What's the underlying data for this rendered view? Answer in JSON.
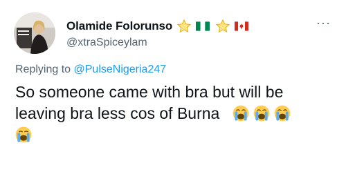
{
  "author": {
    "display_name": "Olamide Folorunso",
    "handle": "@xtraSpiceylam",
    "badges": [
      "star-icon",
      "nigeria-flag-icon",
      "star-icon",
      "canada-flag-icon"
    ]
  },
  "reply": {
    "prefix": "Replying to",
    "mention": "@PulseNigeria247"
  },
  "tweet": {
    "text": "So someone came with bra but will be leaving bra less cos of Burna",
    "emojis": [
      "loudly-crying-face-icon",
      "loudly-crying-face-icon",
      "loudly-crying-face-icon",
      "loudly-crying-face-icon"
    ]
  },
  "colors": {
    "text": "#0f1419",
    "muted": "#536471",
    "link": "#1d9bf0"
  }
}
